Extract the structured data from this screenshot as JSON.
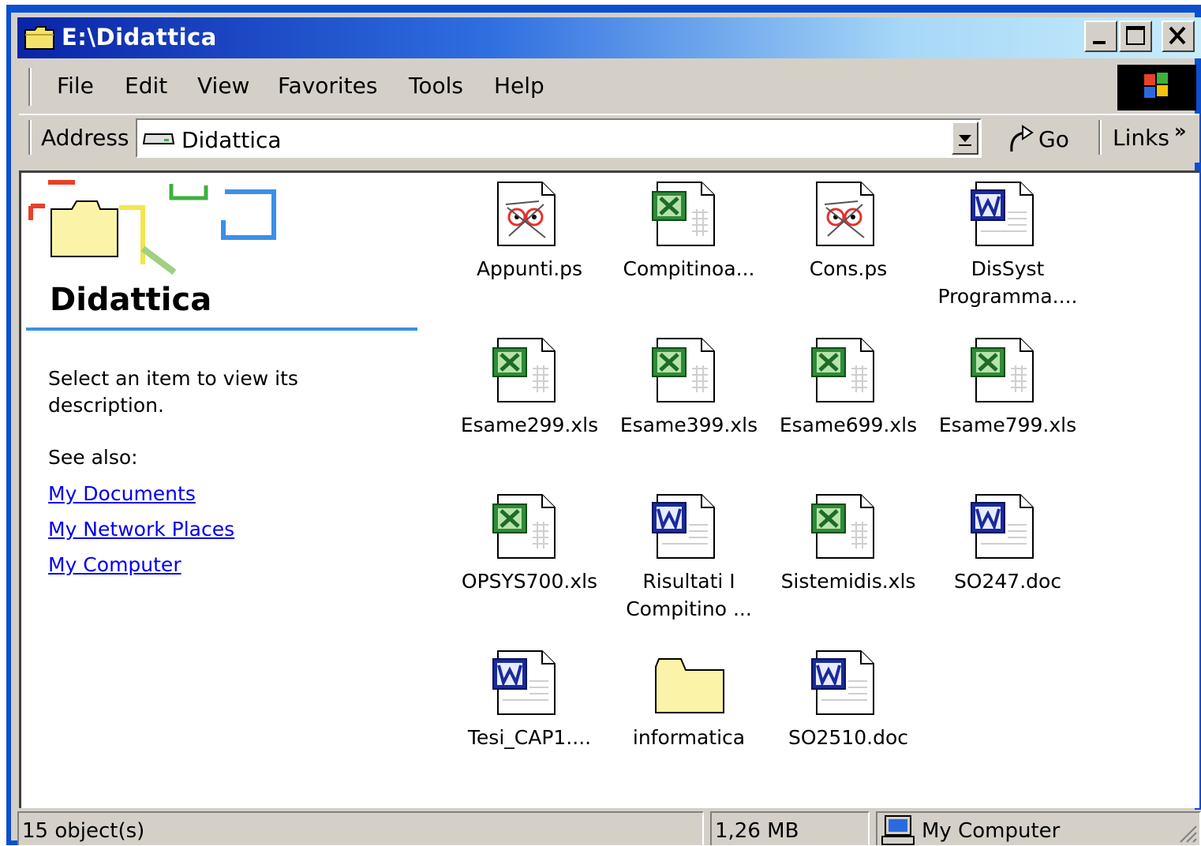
{
  "window": {
    "title": "E:\\Didattica"
  },
  "menu": {
    "items": [
      "File",
      "Edit",
      "View",
      "Favorites",
      "Tools",
      "Help"
    ]
  },
  "address": {
    "label": "Address",
    "value": "Didattica",
    "go_label": "Go",
    "links_label": "Links"
  },
  "left_panel": {
    "folder_title": "Didattica",
    "description": "Select an item to view its description.",
    "see_also_label": "See also:",
    "links": [
      "My Documents",
      "My Network Places",
      "My Computer"
    ]
  },
  "files": [
    {
      "name": "Appunti.ps",
      "icon": "ps-document-icon"
    },
    {
      "name": "Compitinoa...",
      "icon": "excel-document-icon"
    },
    {
      "name": "Cons.ps",
      "icon": "ps-document-icon"
    },
    {
      "name": "DisSyst\nProgramma....",
      "icon": "word-document-icon"
    },
    {
      "name": "Esame299.xls",
      "icon": "excel-document-icon"
    },
    {
      "name": "Esame399.xls",
      "icon": "excel-document-icon"
    },
    {
      "name": "Esame699.xls",
      "icon": "excel-document-icon"
    },
    {
      "name": "Esame799.xls",
      "icon": "excel-document-icon"
    },
    {
      "name": "OPSYS700.xls",
      "icon": "excel-document-icon"
    },
    {
      "name": "Risultati I\nCompitino ...",
      "icon": "word-document-icon"
    },
    {
      "name": "Sistemidis.xls",
      "icon": "excel-document-icon"
    },
    {
      "name": "SO247.doc",
      "icon": "word-document-icon"
    },
    {
      "name": "Tesi_CAP1....",
      "icon": "word-document-icon"
    },
    {
      "name": "informatica",
      "icon": "folder-icon"
    },
    {
      "name": "SO2510.doc",
      "icon": "word-document-icon"
    }
  ],
  "status": {
    "objects": "15 object(s)",
    "size": "1,26 MB",
    "zone": "My Computer"
  },
  "colors": {
    "title_bar_start": "#0a24a8",
    "title_bar_end": "#c7ecfb",
    "link": "#0000ee",
    "excel": "#2e8b3a",
    "word": "#1a2a9c"
  }
}
